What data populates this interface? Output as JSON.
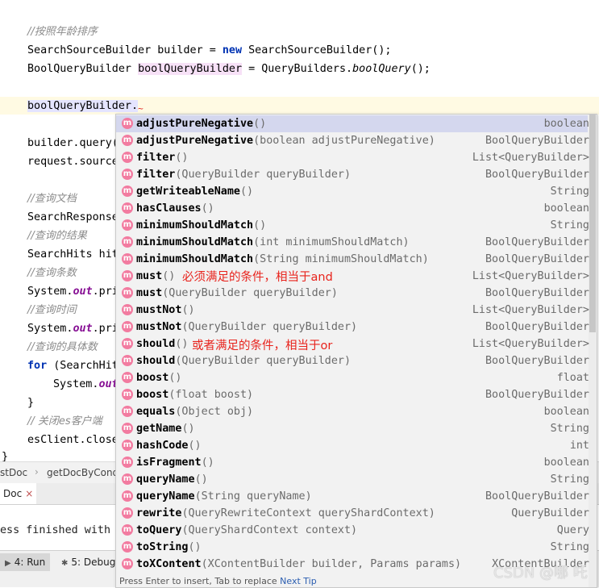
{
  "editor": {
    "lines": {
      "l1": "//按照年龄排序",
      "l2_a": "SearchSourceBuilder builder = ",
      "l2_kw": "new",
      "l2_b": " SearchSourceBuilder();",
      "l3_a": "BoolQueryBuilder ",
      "l3_var": "boolQueryBuilder",
      "l3_b": " = QueryBuilders.",
      "l3_m": "boolQuery",
      "l3_c": "();",
      "l4": "boolQueryBuilder.",
      "l5": "builder.query(",
      "l6": "request.source",
      "l7": "//查询文档",
      "l8": "SearchResponse",
      "l9": "//查询的结果",
      "l10": "SearchHits hit",
      "l11": "//查询条数",
      "l12_a": "System.",
      "l12_f": "out",
      "l12_b": ".pri",
      "l13": "//查询时间",
      "l14_a": "System.",
      "l14_f": "out",
      "l14_b": ".pri",
      "l15": "//查询的具体数",
      "l16_kw": "for",
      "l16_b": " (SearchHit",
      "l17_a": "System.",
      "l17_f": "out",
      "l18": "}",
      "l19": "// 关闭es客户端",
      "l20": "esClient.close",
      "l21": "}"
    }
  },
  "breadcrumbs": {
    "item1": "stDoc",
    "item2": "getDocByCond"
  },
  "run_tabs": {
    "tab_label": "Doc",
    "close": "×"
  },
  "console": {
    "text": "ess finished with"
  },
  "bottom_toolbar": {
    "run_label": "4: Run",
    "debug_label": "5: Debug"
  },
  "completion": {
    "items": [
      {
        "name": "adjustPureNegative",
        "params": "()",
        "type": "boolean"
      },
      {
        "name": "adjustPureNegative",
        "params": "(boolean adjustPureNegative)",
        "type": "BoolQueryBuilder"
      },
      {
        "name": "filter",
        "params": "()",
        "type": "List<QueryBuilder>"
      },
      {
        "name": "filter",
        "params": "(QueryBuilder queryBuilder)",
        "type": "BoolQueryBuilder"
      },
      {
        "name": "getWriteableName",
        "params": "()",
        "type": "String"
      },
      {
        "name": "hasClauses",
        "params": "()",
        "type": "boolean"
      },
      {
        "name": "minimumShouldMatch",
        "params": "()",
        "type": "String"
      },
      {
        "name": "minimumShouldMatch",
        "params": "(int minimumShouldMatch)",
        "type": "BoolQueryBuilder"
      },
      {
        "name": "minimumShouldMatch",
        "params": "(String minimumShouldMatch)",
        "type": "BoolQueryBuilder"
      },
      {
        "name": "must",
        "params": "()",
        "type": "List<QueryBuilder>"
      },
      {
        "name": "must",
        "params": "(QueryBuilder queryBuilder)",
        "type": "BoolQueryBuilder"
      },
      {
        "name": "mustNot",
        "params": "()",
        "type": "List<QueryBuilder>"
      },
      {
        "name": "mustNot",
        "params": "(QueryBuilder queryBuilder)",
        "type": "BoolQueryBuilder"
      },
      {
        "name": "should",
        "params": "()",
        "type": "List<QueryBuilder>"
      },
      {
        "name": "should",
        "params": "(QueryBuilder queryBuilder)",
        "type": "BoolQueryBuilder"
      },
      {
        "name": "boost",
        "params": "()",
        "type": "float"
      },
      {
        "name": "boost",
        "params": "(float boost)",
        "type": "BoolQueryBuilder"
      },
      {
        "name": "equals",
        "params": "(Object obj)",
        "type": "boolean"
      },
      {
        "name": "getName",
        "params": "()",
        "type": "String"
      },
      {
        "name": "hashCode",
        "params": "()",
        "type": "int"
      },
      {
        "name": "isFragment",
        "params": "()",
        "type": "boolean"
      },
      {
        "name": "queryName",
        "params": "()",
        "type": "String"
      },
      {
        "name": "queryName",
        "params": "(String queryName)",
        "type": "BoolQueryBuilder"
      },
      {
        "name": "rewrite",
        "params": "(QueryRewriteContext queryShardContext)",
        "type": "QueryBuilder"
      },
      {
        "name": "toQuery",
        "params": "(QueryShardContext context)",
        "type": "Query"
      },
      {
        "name": "toString",
        "params": "()",
        "type": "String"
      },
      {
        "name": "toXContent",
        "params": "(XContentBuilder builder, Params params)",
        "type": "XContentBuilder"
      }
    ],
    "icon_letter": "m",
    "annotation_must": "必须满足的条件，相当于and",
    "annotation_should": "或者满足的条件，相当于or",
    "hint_text": "Press Enter to insert, Tab to replace ",
    "hint_link": "Next Tip"
  },
  "watermark": "CSDN @哪 吒",
  "colors": {
    "method_icon": "#f27ba0",
    "selection": "#d4d7ee",
    "annotation": "#e8231c",
    "keyword": "#0033b3"
  }
}
